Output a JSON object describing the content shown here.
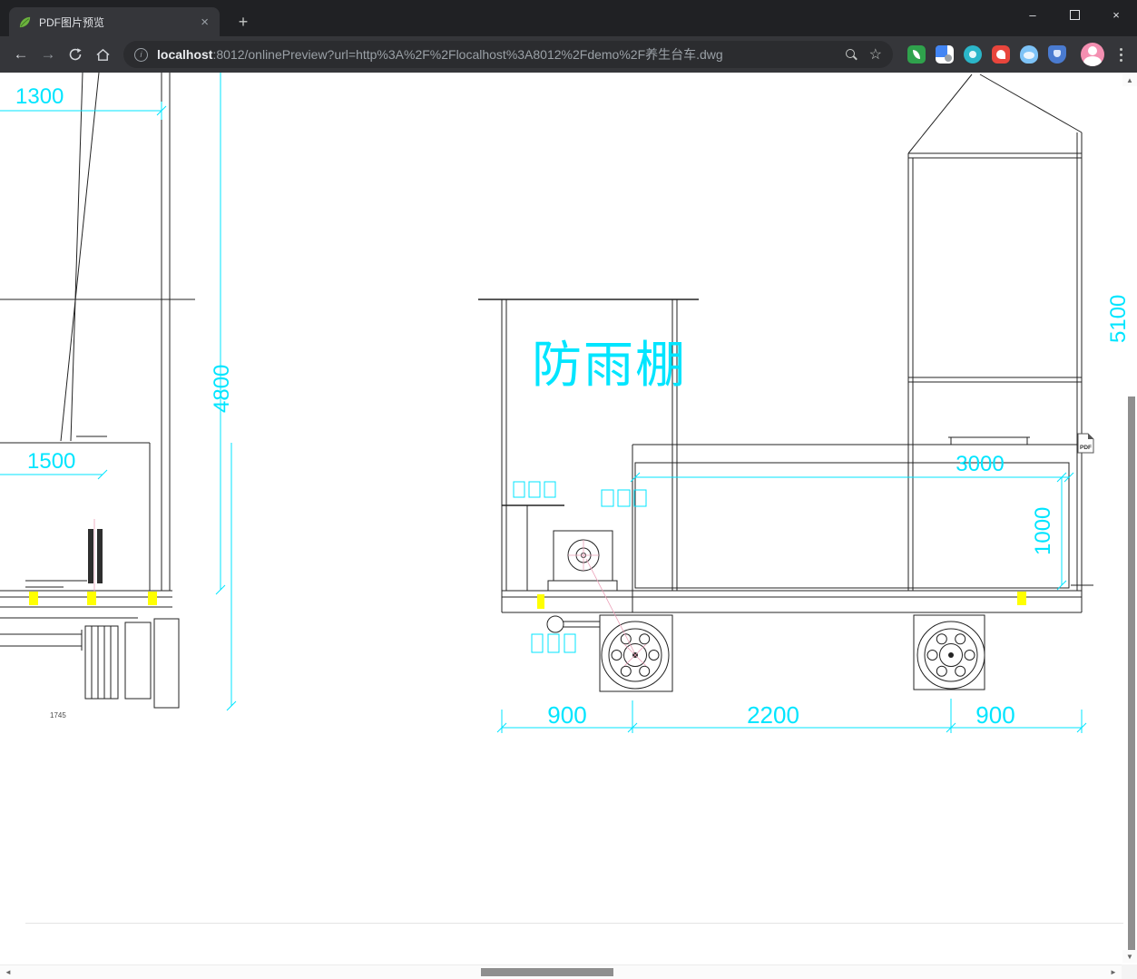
{
  "window": {
    "title": "PDF图片预览",
    "close_tab": "×",
    "new_tab": "+",
    "minimize": "–",
    "close": "×"
  },
  "toolbar": {
    "back": "←",
    "forward": "→",
    "star": "☆",
    "info": "i",
    "url_host": "localhost",
    "url_rest": ":8012/onlinePreview?url=http%3A%2F%2Flocalhost%3A8012%2Fdemo%2F养生台车.dwg"
  },
  "scrollbar": {
    "up": "▲",
    "down": "▼",
    "left": "◄",
    "right": "►"
  },
  "drawing": {
    "shelter_label": "防雨棚",
    "pdf_badge": "PDF",
    "dims": {
      "d1300": "1300",
      "d4800": "4800",
      "d1500": "1500",
      "d1745": "1745",
      "d3000": "3000",
      "d1000": "1000",
      "d5100": "5100",
      "d900a": "900",
      "d2200": "2200",
      "d900b": "900"
    },
    "colors": {
      "dimension_cyan": "#00e5ff",
      "line_black": "#232323",
      "highlight_yellow": "#ffff00"
    }
  }
}
